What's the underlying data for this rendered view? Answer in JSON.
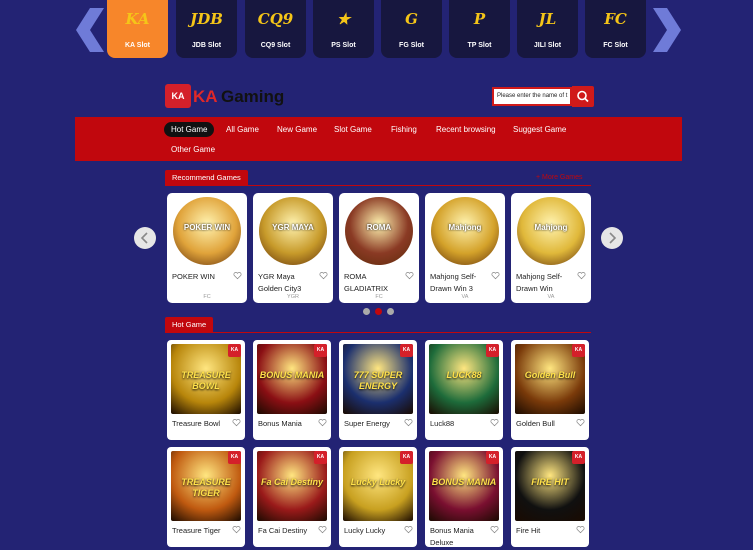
{
  "providers": [
    {
      "label": "KA Slot",
      "logo": "KA",
      "active": true
    },
    {
      "label": "JDB Slot",
      "logo": "JDB",
      "active": false
    },
    {
      "label": "CQ9 Slot",
      "logo": "CQ9",
      "active": false
    },
    {
      "label": "PS Slot",
      "logo": "★",
      "active": false
    },
    {
      "label": "FG Slot",
      "logo": "G",
      "active": false
    },
    {
      "label": "TP Slot",
      "logo": "P",
      "active": false
    },
    {
      "label": "JILI Slot",
      "logo": "JL",
      "active": false
    },
    {
      "label": "FC Slot",
      "logo": "FC",
      "active": false
    }
  ],
  "brand": {
    "icon_text": "KA",
    "name_red": "KA",
    "name_black": "Gaming"
  },
  "search": {
    "placeholder": "Please enter the name of t"
  },
  "nav": [
    {
      "label": "Hot Game",
      "active": true
    },
    {
      "label": "All Game"
    },
    {
      "label": "New Game"
    },
    {
      "label": "Slot Game"
    },
    {
      "label": "Fishing"
    },
    {
      "label": "Recent browsing"
    },
    {
      "label": "Suggest Game"
    },
    {
      "label": "Other Game"
    }
  ],
  "recommend": {
    "title": "Recommend Games",
    "more": "+ More Games",
    "games": [
      {
        "name": "POKER WIN",
        "provider": "FC",
        "art_text": "POKER WIN",
        "color": "#e0a33a"
      },
      {
        "name": "YGR Maya Golden City3",
        "provider": "YGR",
        "art_text": "YGR MAYA",
        "color": "#c79a2a"
      },
      {
        "name": "ROMA GLADIATRIX",
        "provider": "FC",
        "art_text": "ROMA",
        "color": "#8a3a24"
      },
      {
        "name": "Mahjong Self-Drawn Win 3",
        "provider": "VA",
        "art_text": "Mahjong",
        "color": "#d4a22a"
      },
      {
        "name": "Mahjong Self-Drawn Win",
        "provider": "VA",
        "art_text": "Mahjong",
        "color": "#e0b83a"
      }
    ]
  },
  "hot": {
    "title": "Hot Game",
    "badge": "KA",
    "games": [
      {
        "name": "Treasure Bowl",
        "art_text": "TREASURE BOWL",
        "color": "#b8860b"
      },
      {
        "name": "Bonus Mania",
        "art_text": "BONUS MANIA",
        "color": "#8b0f14"
      },
      {
        "name": "Super Energy",
        "art_text": "777 SUPER ENERGY",
        "color": "#1b2f6e"
      },
      {
        "name": "Luck88",
        "art_text": "LUCK88",
        "color": "#1d6b3a"
      },
      {
        "name": "Golden Bull",
        "art_text": "Golden Bull",
        "color": "#7a3a0a"
      },
      {
        "name": "Treasure Tiger",
        "art_text": "TREASURE TIGER",
        "color": "#c05a10"
      },
      {
        "name": "Fa Cai Destiny",
        "art_text": "Fa Cai Destiny",
        "color": "#9a1a1a"
      },
      {
        "name": "Lucky Lucky",
        "art_text": "Lucky Lucky",
        "color": "#c8a020"
      },
      {
        "name": "Bonus Mania Deluxe",
        "art_text": "BONUS MANIA",
        "color": "#7a0f30"
      },
      {
        "name": "Fire Hit",
        "art_text": "FIRE HIT",
        "color": "#101010"
      }
    ]
  }
}
